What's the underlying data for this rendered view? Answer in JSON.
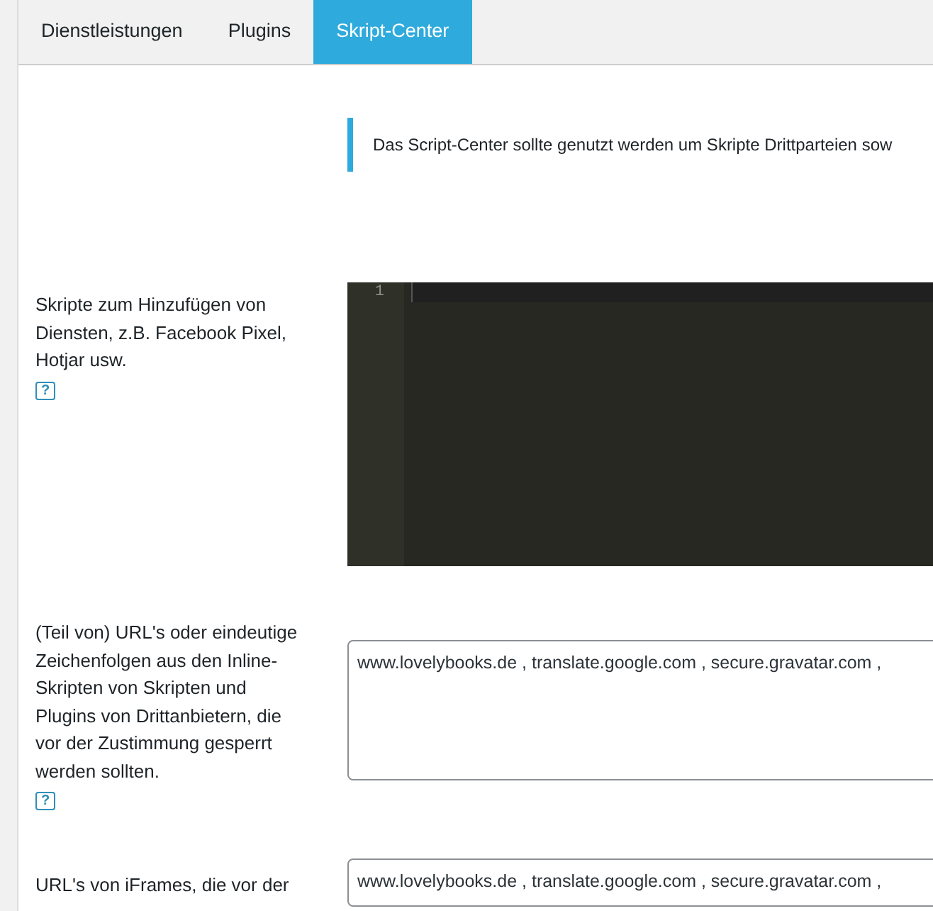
{
  "tabs": [
    {
      "label": "Dienstleistungen",
      "selected": false
    },
    {
      "label": "Plugins",
      "selected": false
    },
    {
      "label": "Skript-Center",
      "selected": true
    }
  ],
  "notice": "Das Script-Center sollte genutzt werden um Skripte Drittparteien sow",
  "fields": [
    {
      "kind": "code",
      "label": "Skripte zum Hinzufügen von Diensten, z.B. Facebook Pixel, Hotjar usw.",
      "help": "?",
      "line_numbers": [
        "1"
      ]
    },
    {
      "kind": "textarea",
      "label": "(Teil von) URL's oder eindeutige Zeichenfolgen aus den Inline-Skripten von Skripten und Plugins von Drittanbietern, die vor der Zustimmung gesperrt werden sollten.",
      "help": "?",
      "value": "www.lovelybooks.de , translate.google.com , secure.gravatar.com ,"
    },
    {
      "kind": "textarea",
      "label": "URL's von iFrames, die vor der",
      "value": "www.lovelybooks.de , translate.google.com , secure.gravatar.com ,"
    }
  ]
}
